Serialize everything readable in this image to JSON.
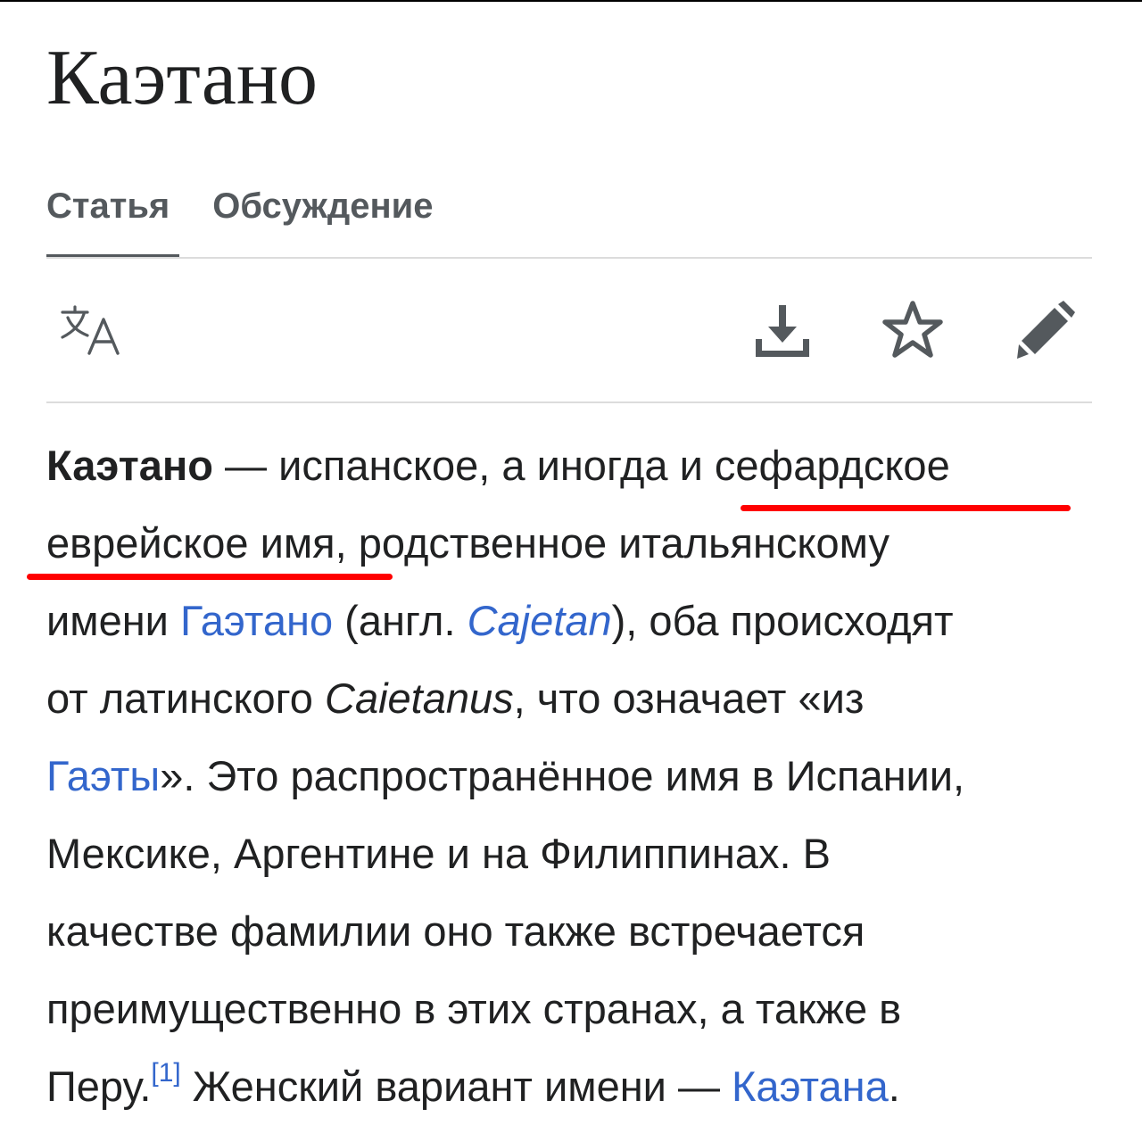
{
  "page": {
    "title": "Каэтано"
  },
  "tabs": [
    {
      "label": "Статья",
      "active": true
    },
    {
      "label": "Обсуждение",
      "active": false
    }
  ],
  "toolbar": {
    "icons": [
      "language-translate-icon",
      "download-icon",
      "star-icon",
      "edit-pencil-icon"
    ]
  },
  "article": {
    "l1_bold": "Каэтано",
    "l1_text": " — испанское, а иногда и сефардское",
    "l2_text": "еврейское имя, родственное итальянскому",
    "l3_a": "имени ",
    "l3_link": "Гаэтано",
    "l3_b": " (англ. ",
    "l3_ital_link": "Cajetan",
    "l3_c": "), оба происходят",
    "l4_a": "от латинского ",
    "l4_ital": "Caietanus",
    "l4_b": ", что означает «из",
    "l5_link": "Гаэты",
    "l5_text": "». Это распространённое имя в Испании,",
    "l6_text": "Мексике, Аргентине и на Филиппинах. В",
    "l7_text": "качестве фамилии оно также встречается",
    "l8_text": "преимущественно в этих странах, а также в",
    "l9_a": "Перу.",
    "l9_ref": "[1]",
    "l9_b": " Женский вариант имени — ",
    "l9_link": "Каэтана",
    "l9_c": "."
  },
  "colors": {
    "text": "#202122",
    "link": "#3366cc",
    "tab": "#54595d",
    "highlight_underline": "#ff0000"
  }
}
